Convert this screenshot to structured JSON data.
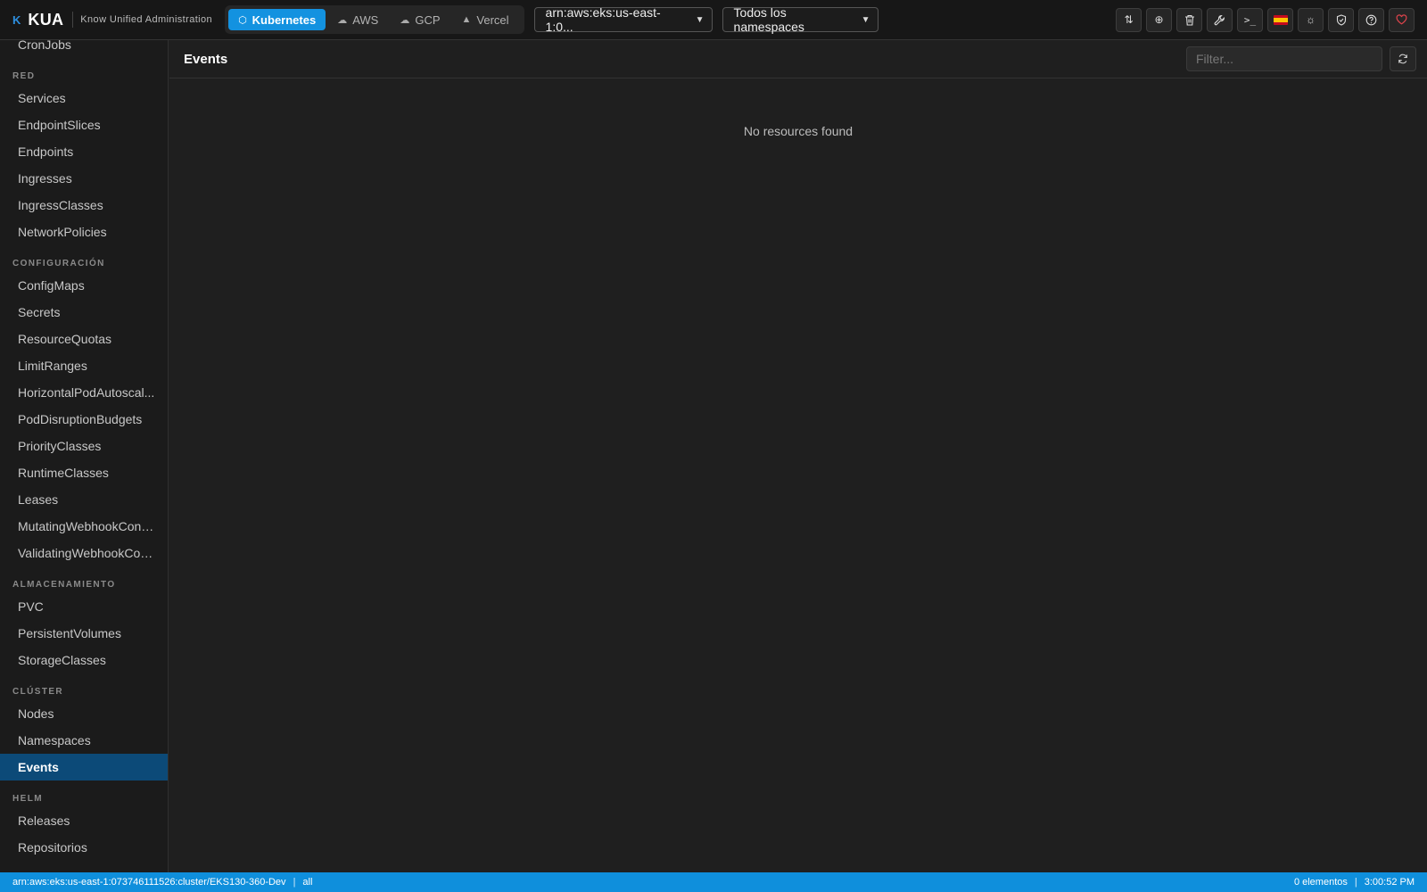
{
  "app": {
    "logo_mark": "K",
    "name": "KUA",
    "tagline": "Know Unified Administration"
  },
  "providers": [
    {
      "label": "Kubernetes",
      "icon": "cube-icon",
      "active": true
    },
    {
      "label": "AWS",
      "icon": "cloud-icon",
      "active": false
    },
    {
      "label": "GCP",
      "icon": "cloud-upload-icon",
      "active": false
    },
    {
      "label": "Vercel",
      "icon": "triangle-icon",
      "active": false
    }
  ],
  "context_select": {
    "value": "arn:aws:eks:us-east-1:0..."
  },
  "namespace_select": {
    "value": "Todos los namespaces"
  },
  "toolbar_icons": [
    "diff-icon",
    "add-circle-icon",
    "trash-icon",
    "wrench-icon",
    "terminal-icon",
    "spain-flag-icon",
    "sun-icon",
    "shield-icon",
    "help-icon",
    "heart-icon"
  ],
  "sidebar": {
    "items": [
      {
        "label": "CronJobs"
      },
      {
        "section": "RED"
      },
      {
        "label": "Services"
      },
      {
        "label": "EndpointSlices"
      },
      {
        "label": "Endpoints"
      },
      {
        "label": "Ingresses"
      },
      {
        "label": "IngressClasses"
      },
      {
        "label": "NetworkPolicies"
      },
      {
        "section": "CONFIGURACIÓN"
      },
      {
        "label": "ConfigMaps"
      },
      {
        "label": "Secrets"
      },
      {
        "label": "ResourceQuotas"
      },
      {
        "label": "LimitRanges"
      },
      {
        "label": "HorizontalPodAutoscal..."
      },
      {
        "label": "PodDisruptionBudgets"
      },
      {
        "label": "PriorityClasses"
      },
      {
        "label": "RuntimeClasses"
      },
      {
        "label": "Leases"
      },
      {
        "label": "MutatingWebhookConfi..."
      },
      {
        "label": "ValidatingWebhookCon..."
      },
      {
        "section": "ALMACENAMIENTO"
      },
      {
        "label": "PVC"
      },
      {
        "label": "PersistentVolumes"
      },
      {
        "label": "StorageClasses"
      },
      {
        "section": "CLÚSTER"
      },
      {
        "label": "Nodes"
      },
      {
        "label": "Namespaces"
      },
      {
        "label": "Events",
        "active": true
      },
      {
        "section": "HELM"
      },
      {
        "label": "Releases"
      },
      {
        "label": "Repositorios"
      }
    ]
  },
  "main": {
    "title": "Events",
    "filter_placeholder": "Filter...",
    "empty_message": "No resources found"
  },
  "statusbar": {
    "context": "arn:aws:eks:us-east-1:073746111526:cluster/EKS130-360-Dev",
    "separator": "|",
    "namespace": "all",
    "count": "0 elementos",
    "time": "3:00:52 PM"
  },
  "colors": {
    "accent": "#1392e0",
    "active_sidebar": "#0c4a78",
    "statusbar": "#0f8fdc"
  }
}
